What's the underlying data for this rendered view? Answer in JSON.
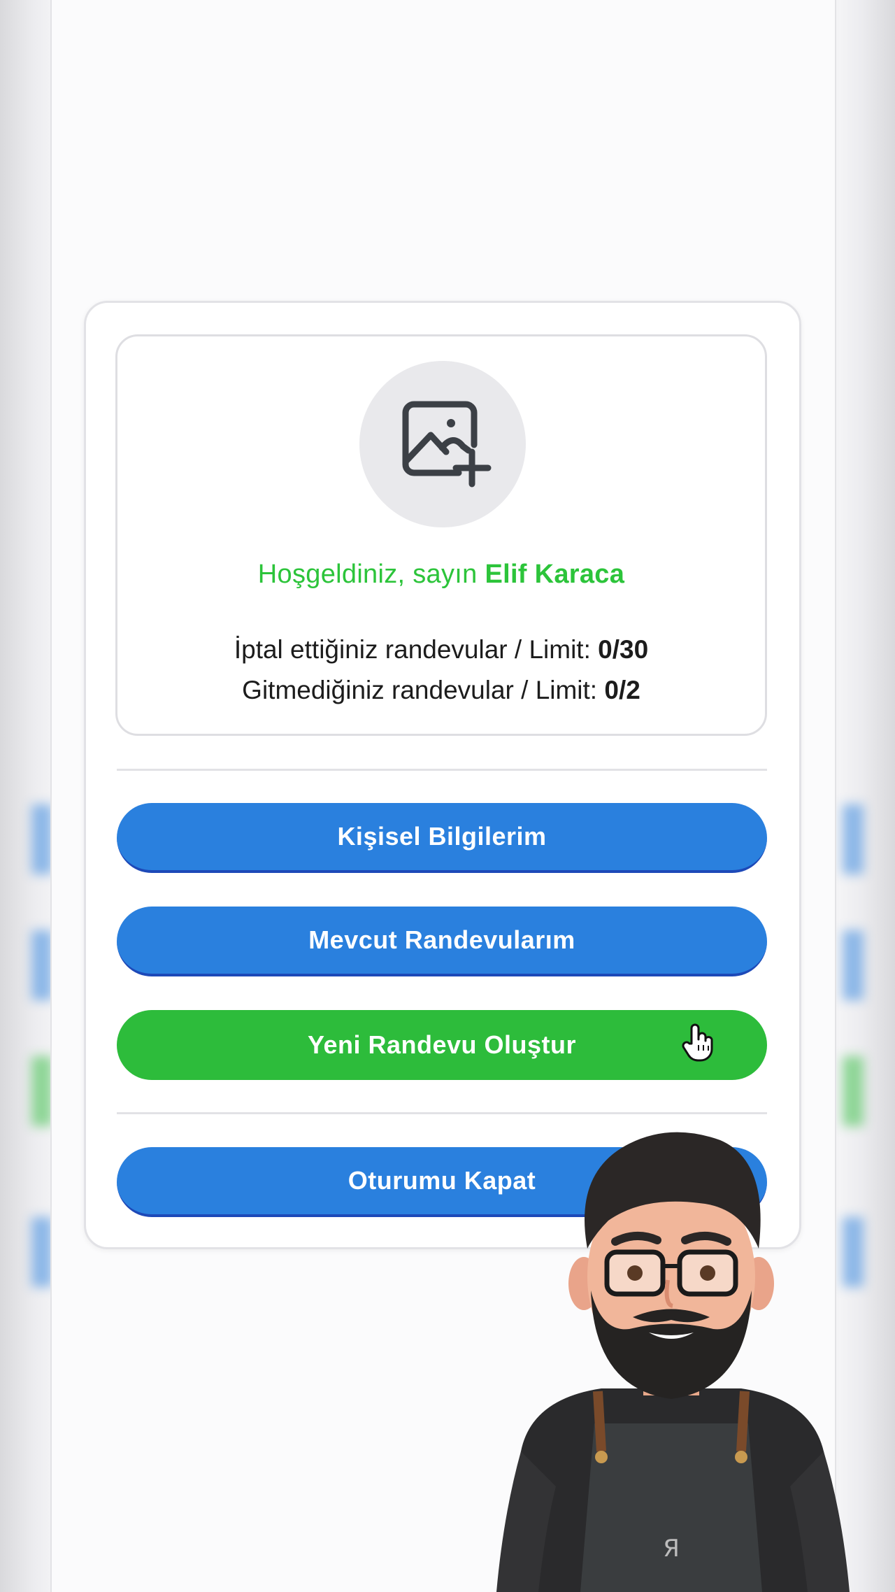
{
  "profile": {
    "welcome_prefix": "Hoşgeldiniz, sayın",
    "user_name": "Elif Karaca",
    "cancelled_label": "İptal ettiğiniz randevular / Limit:",
    "cancelled_value": "0/30",
    "missed_label": "Gitmediğiniz randevular / Limit:",
    "missed_value": "0/2",
    "avatar_icon": "image-add-icon"
  },
  "menu": {
    "personal_info": "Kişisel Bilgilerim",
    "current_appointments": "Mevcut Randevularım",
    "new_appointment": "Yeni Randevu Oluştur",
    "logout": "Oturumu Kapat"
  },
  "colors": {
    "primary_blue": "#2a80de",
    "success_green": "#2dbc3b",
    "welcome_green": "#2cc43a"
  }
}
